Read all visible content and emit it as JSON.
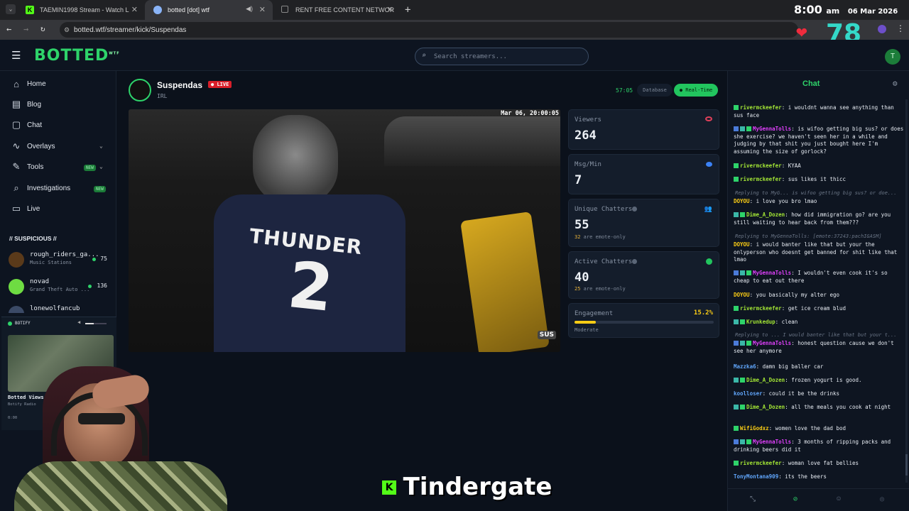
{
  "browser": {
    "tabs": [
      {
        "title": "TAEMIN1998 Stream - Watch L",
        "active": false,
        "favicon": "kick-k"
      },
      {
        "title": "botted [dot] wtf",
        "active": true,
        "favicon": "botted-logo"
      },
      {
        "title": "RENT FREE CONTENT NETWOR",
        "active": false,
        "favicon": "page-icon"
      }
    ],
    "url": "botted.wtf/streamer/kick/Suspendas",
    "avatar": "T"
  },
  "overlay": {
    "time": "8:00",
    "ampm": "am",
    "date": "06 Mar 2026",
    "heart_count": "78",
    "caption": "Tindergate",
    "caption_prefix": "K"
  },
  "header": {
    "logo": "BOTTED",
    "logo_sup": "WTF",
    "search_placeholder": "Search streamers...",
    "user_initial": "T"
  },
  "sidebar": {
    "nav": [
      {
        "label": "Home",
        "icon": "home-icon"
      },
      {
        "label": "Blog",
        "icon": "document-icon"
      },
      {
        "label": "Chat",
        "icon": "chat-bubble-icon"
      },
      {
        "label": "Overlays",
        "icon": "pulse-icon"
      },
      {
        "label": "Tools",
        "icon": "wrench-icon",
        "badge": "NEW"
      },
      {
        "label": "Investigations",
        "icon": "search-icon",
        "badge": "NEW"
      },
      {
        "label": "Live",
        "icon": "tv-icon"
      }
    ],
    "section_title": "// SUSPICIOUS //",
    "suspicious": [
      {
        "name": "rough_riders_ga...",
        "category": "Music Stations",
        "count": "75"
      },
      {
        "name": "novad",
        "category": "Grand Theft Auto ...",
        "count": "136"
      },
      {
        "name": "lonewolfancub",
        "category": "",
        "count": ""
      }
    ],
    "player": {
      "title": "BOTIFY",
      "track": "Botted Views, Borr...",
      "source": "Botify Radio",
      "time": "0:00"
    }
  },
  "stream": {
    "name": "Suspendas",
    "live_label": "LIVE",
    "category": "IRL",
    "timer": "57:05",
    "toggle_database": "Database",
    "toggle_realtime": "Real-Time",
    "video_timestamp": "Mar 06, 20:00:05",
    "jersey_text": "THUNDER",
    "jersey_number": "2",
    "watermark": "SUS"
  },
  "stats": [
    {
      "label": "Viewers",
      "value": "264",
      "sub_num": "",
      "sub_text": "",
      "icon": "eye-icon",
      "color": "#e0405a"
    },
    {
      "label": "Msg/Min",
      "value": "7",
      "sub_num": "",
      "sub_text": "",
      "icon": "message-icon",
      "color": "#3b82f6"
    },
    {
      "label": "Unique Chatters",
      "value": "55",
      "sub_num": "32",
      "sub_text": "are emote-only",
      "icon": "users-icon",
      "color": "#a855f7"
    },
    {
      "label": "Active Chatters",
      "value": "40",
      "sub_num": "25",
      "sub_text": "are emote-only",
      "icon": "check-circle-icon",
      "color": "#22c55e"
    }
  ],
  "engagement": {
    "label": "Engagement",
    "value": "15.2%",
    "level": 0.152,
    "rating": "Moderate"
  },
  "chat": {
    "title": "Chat",
    "messages": [
      {
        "user": "rivermckeefer",
        "color": "#a3e635",
        "text": "i wouldnt wanna see anything than sus face"
      },
      {
        "user": "MyGennaTolls",
        "color": "#e040fb",
        "text": "is wifoo getting big sus? or does she exercise? we haven't seen her in a while and judging by that shit you just bought here I'm assuming the size of gorlock?"
      },
      {
        "user": "rivermckeefer",
        "color": "#a3e635",
        "text": "KYAA"
      },
      {
        "user": "rivermckeefer",
        "color": "#a3e635",
        "text": "sus likes it thicc"
      },
      {
        "user": "DOYOU",
        "color": "#facc15",
        "text": "i love you bro lmao"
      },
      {
        "user": "Dime_A_Dozen",
        "color": "#a3e635",
        "text": "how did immigration go? are you still waiting to hear back from them???"
      },
      {
        "user": "DOYOU",
        "color": "#facc15",
        "text": "i would banter like that but your the onlyperson who doesnt get banned for shit like that lmao"
      },
      {
        "user": "MyGennaTolls",
        "color": "#e040fb",
        "text": "I wouldn't even cook it's so cheap to eat out there"
      },
      {
        "user": "DOYOU",
        "color": "#facc15",
        "text": "you basically my alter ego"
      },
      {
        "user": "rivermckeefer",
        "color": "#a3e635",
        "text": "get ice cream blud"
      },
      {
        "user": "Krunkedup",
        "color": "#a3e635",
        "text": "clean"
      },
      {
        "user": "MyGennaTolls",
        "color": "#e040fb",
        "text": "honest question cause we don't see her anymore"
      },
      {
        "user": "Mazzka6",
        "color": "#60a5fa",
        "text": "damn big baller car"
      },
      {
        "user": "Dime_A_Dozen",
        "color": "#a3e635",
        "text": "frozen yogurt is good."
      },
      {
        "user": "koolloser",
        "color": "#60a5fa",
        "text": "could it be the drinks"
      },
      {
        "user": "Dime_A_Dozen",
        "color": "#a3e635",
        "text": "all the meals you cook at night"
      },
      {
        "user": "WifiGodxz",
        "color": "#facc15",
        "text": "women love the dad bod"
      },
      {
        "user": "MyGennaTolls",
        "color": "#e040fb",
        "text": "3 months of ripping packs and drinking beers did it"
      },
      {
        "user": "rivermckeefer",
        "color": "#a3e635",
        "text": "woman love fat bellies"
      },
      {
        "user": "TonyMontana909",
        "color": "#60a5fa",
        "text": "its the beers"
      }
    ],
    "replies": [
      "Replying to MyG... is wifoo getting big sus? or doe...",
      "Replying to MyGennaTolls: [emote:37243:pachIGASM]",
      "Replying to ... I would banter like that but your t..."
    ]
  }
}
